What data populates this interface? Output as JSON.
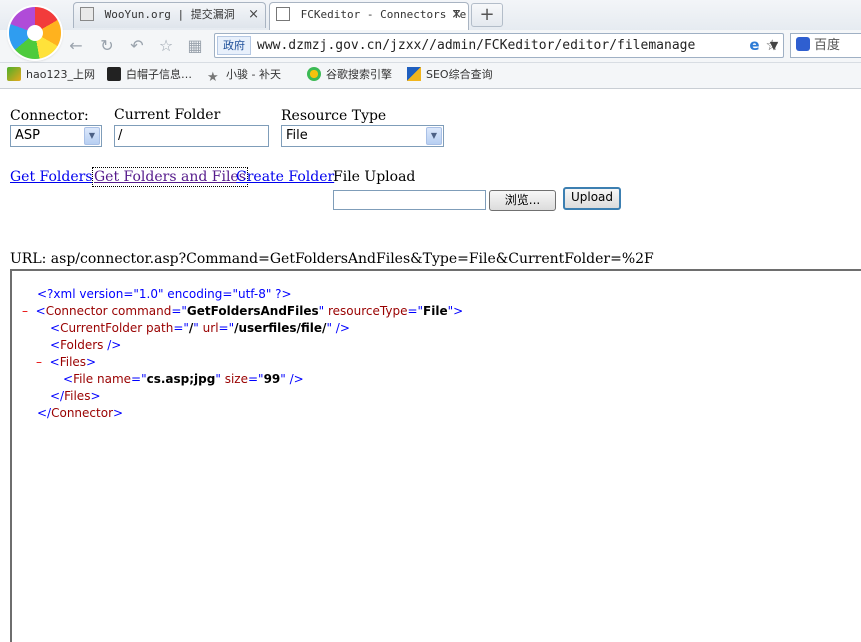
{
  "browser": {
    "tabs": [
      {
        "title": "WooYun.org | 提交漏洞",
        "close": "×"
      },
      {
        "title": "FCKeditor - Connectors Te",
        "close": "×"
      }
    ],
    "new_tab": "+",
    "address": {
      "badge": "政府",
      "url": "www.dzmzj.gov.cn/jzxx//admin/FCKeditor/editor/filemanage",
      "dropdown": "▼"
    },
    "search": {
      "label": "百度"
    },
    "bookmarks": [
      {
        "label": "hao123_上网",
        "icon": "hao123-icon"
      },
      {
        "label": "白帽子信息…",
        "icon": "wooyun-icon"
      },
      {
        "label": "小骏 - 补天",
        "icon": "star-icon"
      },
      {
        "label": "谷歌搜索引擎",
        "icon": "google-icon"
      },
      {
        "label": "SEO综合查询",
        "icon": "seo-icon"
      }
    ]
  },
  "page": {
    "connector": {
      "label": "Connector:",
      "value": "ASP"
    },
    "current_folder": {
      "label": "Current Folder",
      "value": "/"
    },
    "resource_type": {
      "label": "Resource Type",
      "value": "File"
    },
    "links": {
      "get_folders": "Get Folders",
      "get_folders_files": "Get Folders and Files",
      "create_folder": "Create Folder"
    },
    "upload": {
      "label": "File Upload",
      "browse": "浏览...",
      "button": "Upload"
    },
    "url_line": "URL: asp/connector.asp?Command=GetFoldersAndFiles&Type=File&CurrentFolder=%2F",
    "xml": {
      "decl": "<?xml version=\"1.0\" encoding=\"utf-8\" ?>",
      "minus": "–",
      "connector_tag": "Connector",
      "attr_command": "command",
      "command_value": "GetFoldersAndFiles",
      "attr_resource_type": "resourceType",
      "resource_type_value": "File",
      "current_folder_tag": "CurrentFolder",
      "attr_path": "path",
      "path_value": "/",
      "attr_url": "url",
      "url_value": "/userfiles/file/",
      "folders_tag": "Folders",
      "files_tag": "Files",
      "file_tag": "File",
      "attr_name": "name",
      "name_value": "cs.asp;jpg",
      "attr_size": "size",
      "size_value": "99"
    }
  }
}
